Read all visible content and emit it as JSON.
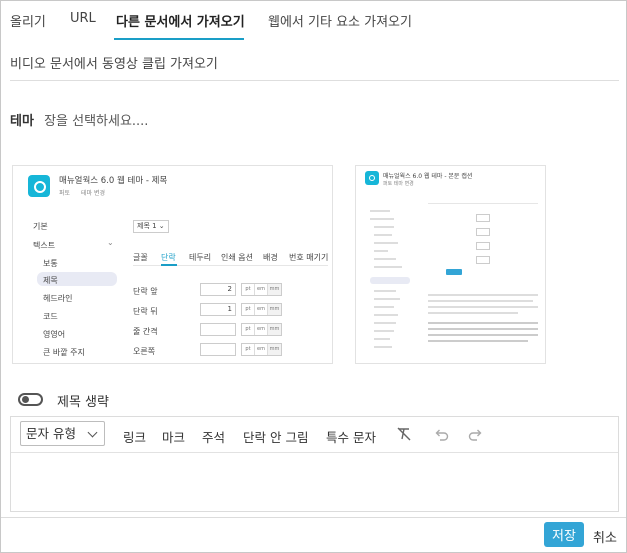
{
  "tabs": [
    {
      "label": "올리기"
    },
    {
      "label": "URL"
    },
    {
      "label": "다른 문서에서 가져오기"
    },
    {
      "label": "웹에서 기타 요소 가져오기"
    },
    {
      "label": "비디오 문서에서 동영상 클립 가져오기"
    }
  ],
  "active_tab_index": 2,
  "theme": {
    "label": "테마",
    "placeholder": "장을 선택하세요...."
  },
  "previews": [
    {
      "title": "매뉴얼웍스 6.0 웹 테마 - 제목",
      "subtitle_left": "퍼토",
      "subtitle_right": "테마 변경",
      "select_value": "제목 1",
      "menu": [
        {
          "label": "기본"
        },
        {
          "label": "텍스트"
        },
        {
          "label": "보통"
        },
        {
          "label": "제목"
        },
        {
          "label": "헤드라인"
        },
        {
          "label": "코드"
        },
        {
          "label": "영영어"
        },
        {
          "label": "큰 바깥 주지"
        }
      ],
      "selected_menu_item": "제목",
      "sub_tabs": [
        "글꼴",
        "단락",
        "테두리",
        "인쇄 옵션",
        "배경",
        "번호 매기기"
      ],
      "active_sub_tab": "단락",
      "fields": [
        {
          "label": "단락 앞",
          "value": "2"
        },
        {
          "label": "단락 뒤",
          "value": "1"
        },
        {
          "label": "줄 간격",
          "value": ""
        },
        {
          "label": "오른쪽",
          "value": ""
        }
      ],
      "units": [
        "pt",
        "em",
        "mm"
      ]
    },
    {
      "title": "매뉴얼웍스 6.0 웹 테마 - 본문 캡션",
      "subtitle": "퍼토 테마 변경"
    }
  ],
  "toggle": {
    "label": "제목 생략",
    "on": false
  },
  "toolbar": {
    "format_select": "문자 유형",
    "link": "링크",
    "mark": "마크",
    "annotation": "주석",
    "inline_image": "단락 안 그림",
    "special_char": "특수 문자"
  },
  "icons": {
    "clear_format": "clear-format-icon",
    "undo": "undo-icon",
    "redo": "redo-icon"
  },
  "footer": {
    "save": "저장",
    "cancel": "취소"
  },
  "colors": {
    "accent": "#1a9ec7",
    "save_button": "#33a5d6",
    "theme_logo": "#16b6d8"
  }
}
